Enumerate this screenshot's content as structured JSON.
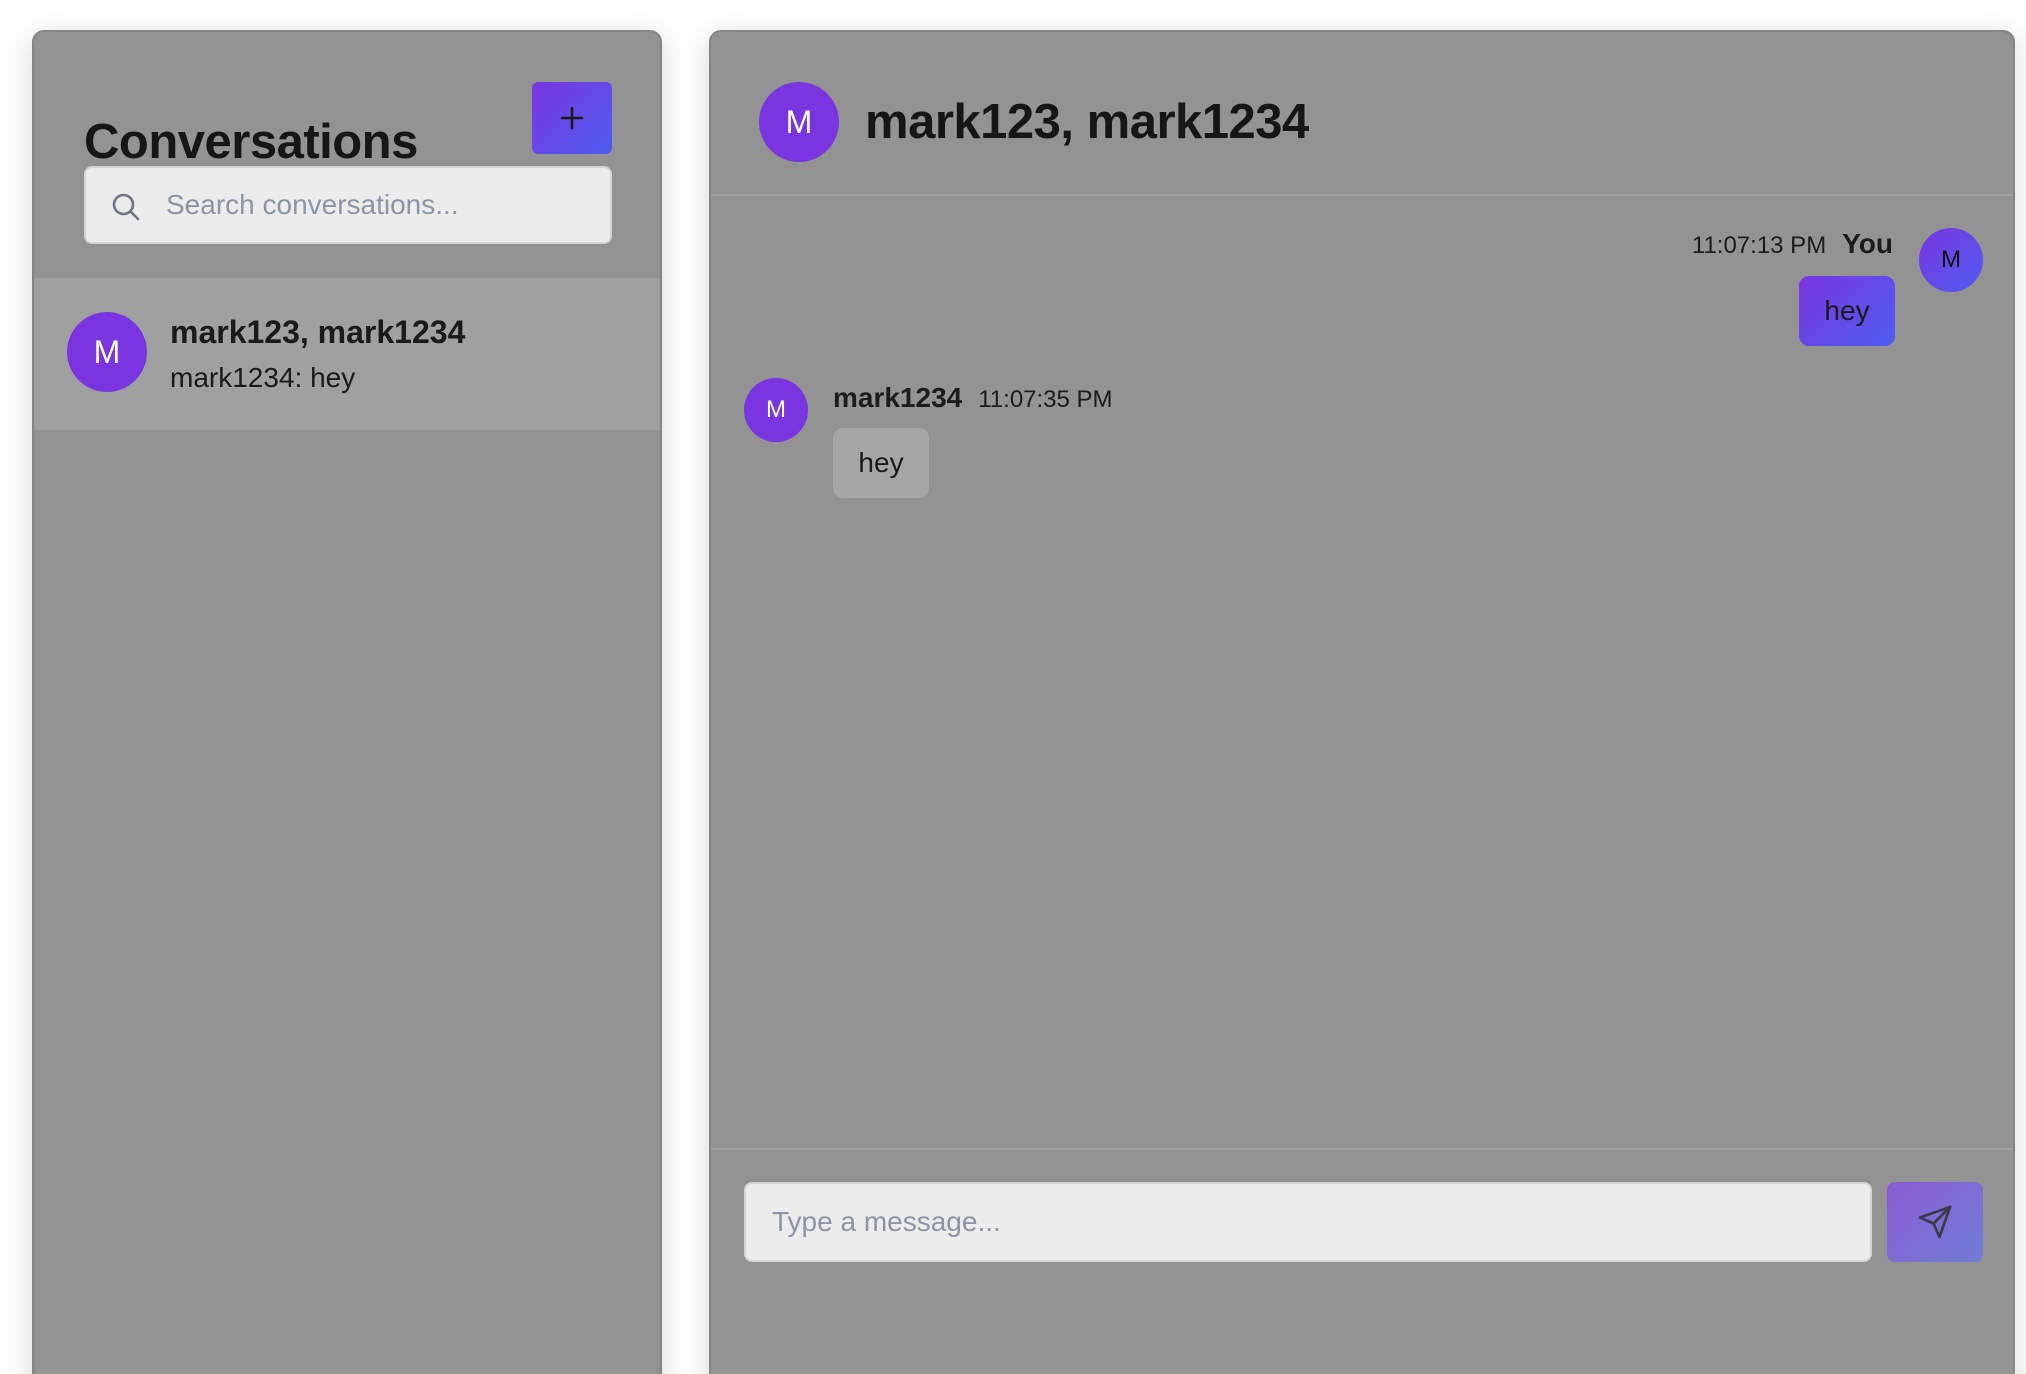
{
  "sidebar": {
    "title": "Conversations",
    "new_button_label": "+",
    "search": {
      "placeholder": "Search conversations...",
      "value": ""
    },
    "conversations": [
      {
        "avatar_letter": "M",
        "name": "mark123, mark1234",
        "preview": "mark1234: hey"
      }
    ]
  },
  "chat": {
    "avatar_letter": "M",
    "title": "mark123, mark1234",
    "messages": [
      {
        "direction": "outgoing",
        "author": "You",
        "time": "11:07:13 PM",
        "text": "hey",
        "avatar_letter": "M"
      },
      {
        "direction": "incoming",
        "author": "mark1234",
        "time": "11:07:35 PM",
        "text": "hey",
        "avatar_letter": "M"
      }
    ],
    "composer": {
      "placeholder": "Type a message...",
      "value": ""
    }
  },
  "colors": {
    "accent_purple": "#7a35e0",
    "accent_blue": "#4e5df0",
    "panel_bg": "#939393",
    "selected_item_bg": "#a0a0a0",
    "input_bg": "#ececec"
  },
  "icons": {
    "search": "search-icon",
    "send": "send-icon",
    "plus": "plus-icon"
  }
}
